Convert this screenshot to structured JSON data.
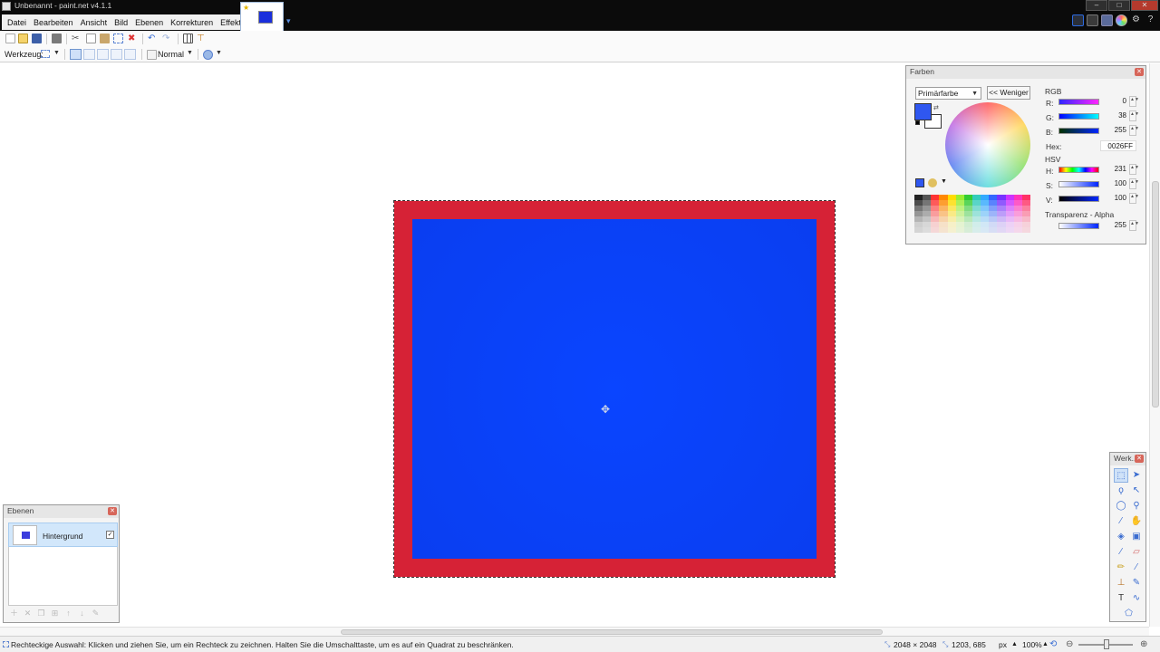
{
  "window": {
    "title": "Unbenannt - paint.net v4.1.1"
  },
  "menu": {
    "items": [
      "Datei",
      "Bearbeiten",
      "Ansicht",
      "Bild",
      "Ebenen",
      "Korrekturen",
      "Effekte"
    ]
  },
  "toolbar": {
    "tool_label": "Werkzeug:",
    "blend_mode": "Normal"
  },
  "colors_panel": {
    "title": "Farben",
    "primary_select": "Primärfarbe",
    "less_button": "<< Weniger",
    "rgb_heading": "RGB",
    "r_label": "R:",
    "r_value": "0",
    "g_label": "G:",
    "g_value": "38",
    "b_label": "B:",
    "b_value": "255",
    "hex_label": "Hex:",
    "hex_value": "0026FF",
    "hsv_heading": "HSV",
    "h_label": "H:",
    "h_value": "231",
    "s_label": "S:",
    "s_value": "100",
    "v_label": "V:",
    "v_value": "100",
    "alpha_heading": "Transparenz - Alpha",
    "alpha_value": "255",
    "primary_color": "#2f57f0",
    "secondary_color": "#ffffff"
  },
  "layers_panel": {
    "title": "Ebenen",
    "layers": [
      {
        "name": "Hintergrund",
        "visible": true
      }
    ]
  },
  "tools_panel": {
    "title": "Werk..."
  },
  "canvas": {
    "border_color": "#d62236",
    "fill_color": "#0a45ff"
  },
  "status": {
    "hint": "Rechteckige Auswahl: Klicken und ziehen Sie, um ein Rechteck zu zeichnen. Halten Sie die Umschalttaste, um es auf ein Quadrat zu beschränken.",
    "image_size": "2048 × 2048",
    "cursor_pos": "1203, 685",
    "unit": "px",
    "zoom": "100%"
  }
}
